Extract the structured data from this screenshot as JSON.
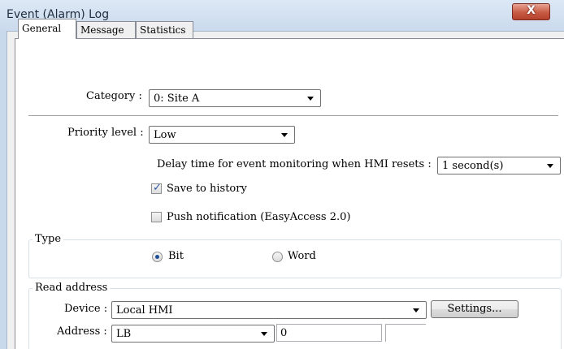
{
  "window": {
    "title": "Event (Alarm) Log",
    "close_glyph": "X"
  },
  "tabs": [
    {
      "label": "General",
      "active": true
    },
    {
      "label": "Message",
      "active": false
    },
    {
      "label": "Statistics",
      "active": false
    }
  ],
  "category": {
    "label": "Category :",
    "value": "0: Site A"
  },
  "priority": {
    "label": "Priority level :",
    "value": "Low"
  },
  "delay": {
    "label": "Delay time for event monitoring when HMI resets :",
    "value": "1 second(s)"
  },
  "save_history": {
    "label": "Save to history",
    "checked": true
  },
  "push_notification": {
    "label": "Push notification (EasyAccess 2.0)",
    "checked": false
  },
  "type_group": {
    "title": "Type",
    "options": [
      {
        "label": "Bit",
        "selected": true
      },
      {
        "label": "Word",
        "selected": false
      }
    ]
  },
  "read_address": {
    "title": "Read address",
    "device_label": "Device :",
    "device_value": "Local HMI",
    "settings_label": "Settings...",
    "address_label": "Address :",
    "address_type": "LB",
    "address_value": "0"
  },
  "icons": {
    "close": "close-icon",
    "dropdown": "chevron-down-icon",
    "check": "checkmark-icon"
  },
  "colors": {
    "titlebar": "#c9d9ec",
    "close": "#c75a43",
    "panel": "#ffffff"
  }
}
